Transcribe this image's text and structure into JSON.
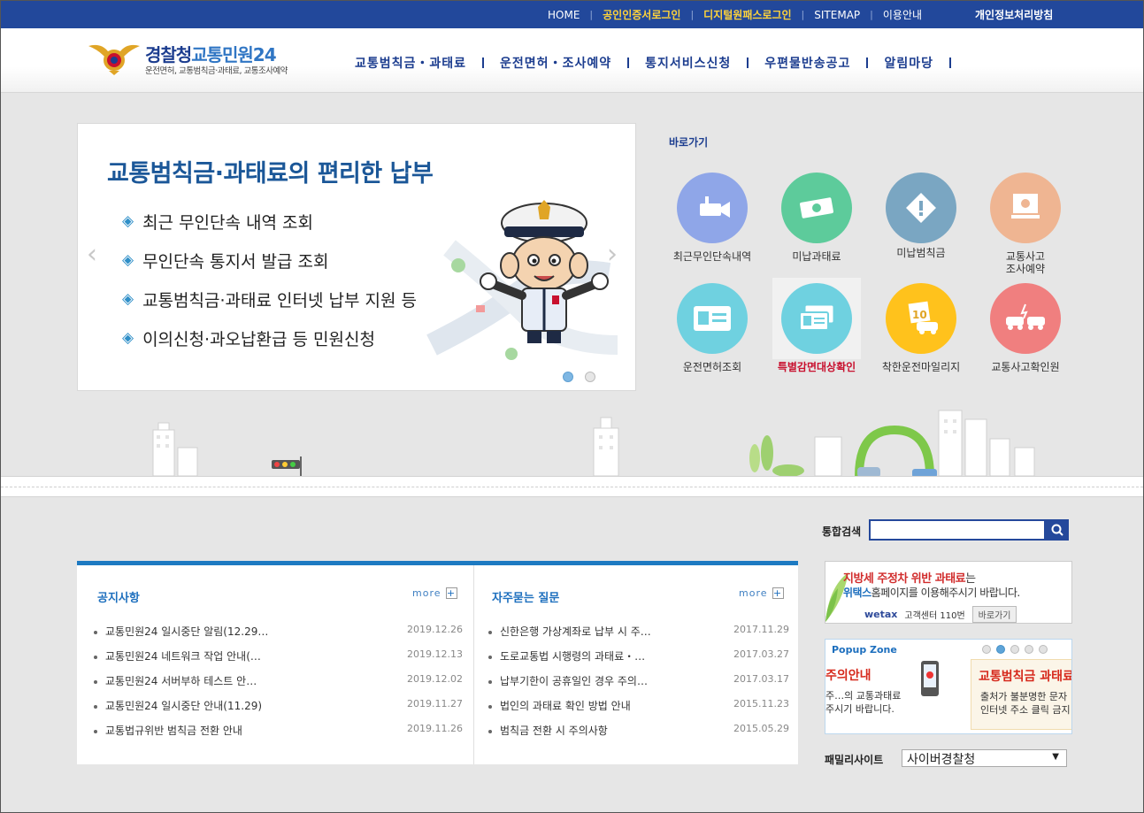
{
  "topbar": {
    "home": "HOME",
    "cert_login": "공인인증서로그인",
    "digital_login": "디지털원패스로그인",
    "sitemap": "SITEMAP",
    "guide": "이용안내",
    "privacy": "개인정보처리방침"
  },
  "logo": {
    "title_a": "경찰청",
    "title_b": "교통민원24",
    "subtitle": "운전면허, 교통범칙금·과태료, 교통조사예약"
  },
  "gnb": [
    "교통범칙금・과태료",
    "운전면허・조사예약",
    "통지서비스신청",
    "우편물반송공고",
    "알림마당"
  ],
  "visual": {
    "title": "교통범칙금·과태료의 편리한 납부",
    "items": [
      "최근 무인단속 내역 조회",
      "무인단속 통지서 발급 조회",
      "교통범칙금·과태료 인터넷 납부 지원 등",
      "이의신청·과오납환급 등 민원신청"
    ],
    "bullet": "◈",
    "prev": "‹",
    "next": "›"
  },
  "quick": {
    "title": "바로가기",
    "items": [
      {
        "label": "최근무인단속내역",
        "icon": "camera-icon",
        "color": "#8fa6e8"
      },
      {
        "label": "미납과태료",
        "icon": "money-icon",
        "color": "#5dcb9b"
      },
      {
        "label": "미납범칙금",
        "icon": "warning-icon",
        "color": "#7aa6c2"
      },
      {
        "label": "교통사고\n조사예약",
        "icon": "computer-icon",
        "color": "#efb592"
      },
      {
        "label": "운전면허조회",
        "icon": "license-icon",
        "color": "#6fd1e0"
      },
      {
        "label": "특별감면대상확인",
        "icon": "id-cards-icon",
        "color": "#6fd1e0"
      },
      {
        "label": "착한운전마일리지",
        "icon": "mileage-icon",
        "color": "#ffc21c"
      },
      {
        "label": "교통사고확인원",
        "icon": "car-crash-icon",
        "color": "#f07f7f"
      }
    ]
  },
  "search": {
    "label": "통합검색",
    "placeholder": ""
  },
  "notice": {
    "title": "공지사항",
    "more": "more",
    "rows": [
      {
        "title": "교통민원24 일시중단 알림(12.29…",
        "date": "2019.12.26"
      },
      {
        "title": "교통민원24 네트워크 작업 안내(…",
        "date": "2019.12.13"
      },
      {
        "title": "교통민원24 서버부하 테스트 안…",
        "date": "2019.12.02"
      },
      {
        "title": "교통민원24 일시중단 안내(11.29)",
        "date": "2019.11.27"
      },
      {
        "title": "교통법규위반 범칙금 전환 안내",
        "date": "2019.11.26"
      }
    ]
  },
  "faq": {
    "title": "자주묻는 질문",
    "more": "more",
    "rows": [
      {
        "title": "신한은행 가상계좌로 납부 시 주…",
        "date": "2017.11.29"
      },
      {
        "title": "도로교통법 시행령의 과태료・…",
        "date": "2017.03.27"
      },
      {
        "title": "납부기한이 공휴일인 경우 주의…",
        "date": "2017.03.17"
      },
      {
        "title": "법인의 과태료 확인 방법 안내",
        "date": "2015.11.23"
      },
      {
        "title": "범칙금 전환 시 주의사항",
        "date": "2015.05.29"
      }
    ]
  },
  "banner": {
    "line1_red": "지방세 주정차 위반 과태료",
    "line1_tail": "는",
    "line2_blue": "위택스",
    "line2_tail": "홈페이지를 이용해주시기 바랍니다.",
    "brand": "wetax",
    "center": "고객센터 110번",
    "go": "바로가기"
  },
  "popup": {
    "title": "Popup Zone",
    "card1_h": "주의안내",
    "card1_s1": "주…의 교통과태료",
    "card1_s2": "주시기 바랍니다.",
    "card2_h": "교통범칙금 과태료",
    "card2_s1": "출처가 불분명한 문자",
    "card2_s2": "인터넷 주소 클릭 금지"
  },
  "family": {
    "label": "패밀리사이트",
    "selected": "사이버경찰청",
    "caret": "▼"
  }
}
